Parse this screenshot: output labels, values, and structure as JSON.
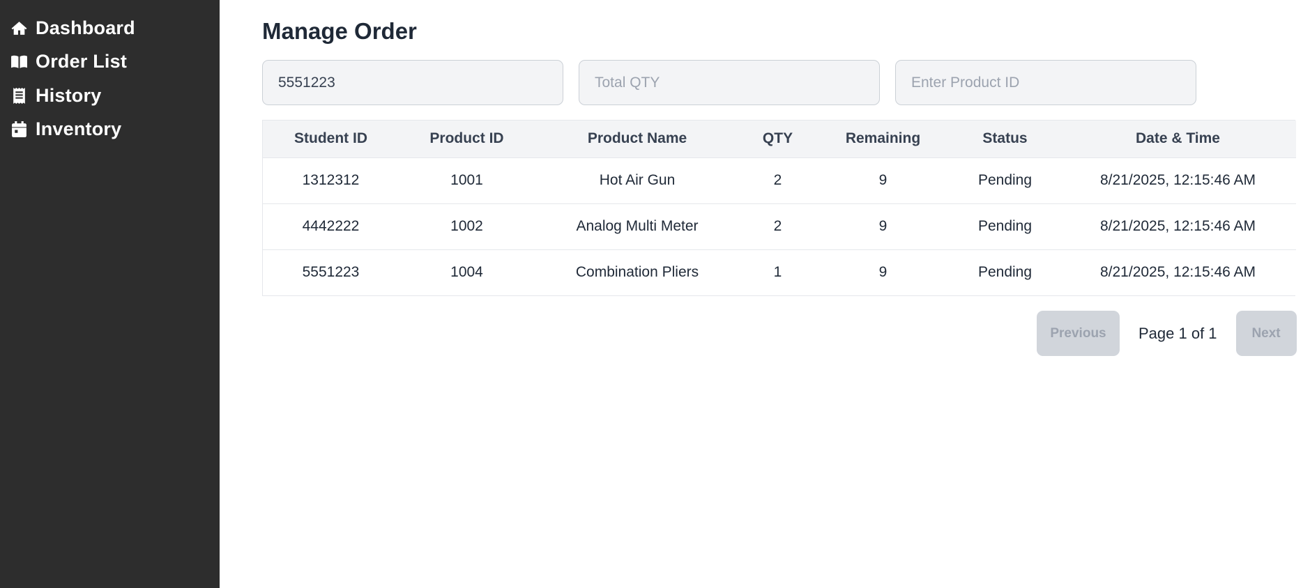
{
  "sidebar": {
    "items": [
      {
        "label": "Dashboard",
        "icon": "home-icon"
      },
      {
        "label": "Order List",
        "icon": "book-icon"
      },
      {
        "label": "History",
        "icon": "receipt-icon"
      },
      {
        "label": "Inventory",
        "icon": "calendar-icon"
      }
    ]
  },
  "main": {
    "title": "Manage Order",
    "filters": {
      "student_value": "5551223",
      "qty_placeholder": "Total QTY",
      "product_placeholder": "Enter Product ID"
    },
    "table": {
      "headers": [
        "Student ID",
        "Product ID",
        "Product Name",
        "QTY",
        "Remaining",
        "Status",
        "Date & Time"
      ],
      "rows": [
        [
          "1312312",
          "1001",
          "Hot Air Gun",
          "2",
          "9",
          "Pending",
          "8/21/2025, 12:15:46 AM"
        ],
        [
          "4442222",
          "1002",
          "Analog Multi Meter",
          "2",
          "9",
          "Pending",
          "8/21/2025, 12:15:46 AM"
        ],
        [
          "5551223",
          "1004",
          "Combination Pliers",
          "1",
          "9",
          "Pending",
          "8/21/2025, 12:15:46 AM"
        ]
      ]
    },
    "pagination": {
      "prev_label": "Previous",
      "page_info": "Page 1 of 1",
      "next_label": "Next"
    }
  },
  "colors": {
    "sidebar_bg": "#2d2d2d",
    "input_bg": "#f3f4f6",
    "header_bg": "#f3f4f6",
    "disabled_btn": "#d1d5db"
  }
}
